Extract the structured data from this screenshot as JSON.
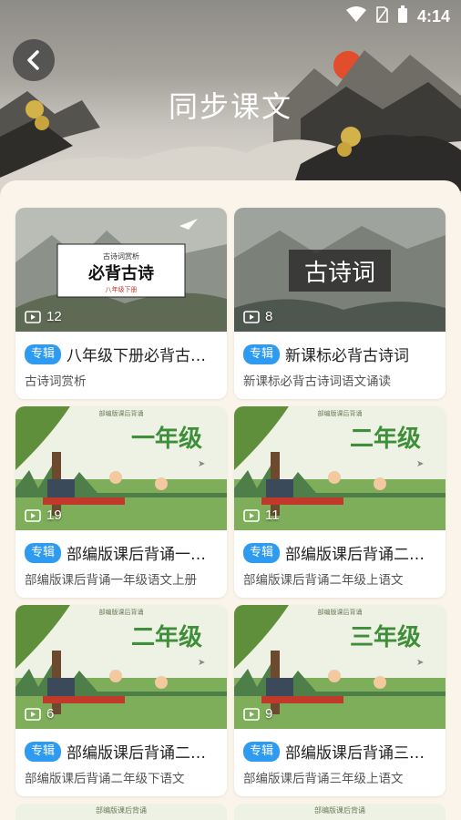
{
  "status_bar": {
    "time": "4:14",
    "icons": [
      "wifi-icon",
      "sim-icon",
      "battery-icon"
    ]
  },
  "header": {
    "title": "同步课文",
    "back_icon": "chevron-left-icon"
  },
  "cards": [
    {
      "badge": "专辑",
      "name": "八年级下册必背古诗词",
      "subtitle": "古诗词赏析",
      "count": "12",
      "theme": "ink",
      "thumb_text": "必背古诗",
      "thumb_top": "古诗词赏析",
      "thumb_bottom": "八年级下册"
    },
    {
      "badge": "专辑",
      "name": "新课标必背古诗词",
      "subtitle": "新课标必背古诗词语文诵读",
      "count": "8",
      "theme": "ink2",
      "thumb_text": "古诗词"
    },
    {
      "badge": "专辑",
      "name": "部编版课后背诵一年级",
      "subtitle": "部编版课后背诵一年级语文上册",
      "count": "19",
      "theme": "grade",
      "thumb_text": "一年级",
      "thumb_top": "部编版课后背诵"
    },
    {
      "badge": "专辑",
      "name": "部编版课后背诵二年级",
      "subtitle": "部编版课后背诵二年级上语文",
      "count": "11",
      "theme": "grade",
      "thumb_text": "二年级",
      "thumb_top": "部编版课后背诵"
    },
    {
      "badge": "专辑",
      "name": "部编版课后背诵二年级",
      "subtitle": "部编版课后背诵二年级下语文",
      "count": "6",
      "theme": "grade",
      "thumb_text": "二年级",
      "thumb_top": "部编版课后背诵"
    },
    {
      "badge": "专辑",
      "name": "部编版课后背诵三年级",
      "subtitle": "部编版课后背诵三年级上语文",
      "count": "9",
      "theme": "grade",
      "thumb_text": "三年级",
      "thumb_top": "部编版课后背诵"
    }
  ],
  "partial": [
    "部编版课后背诵",
    "部编版课后背诵"
  ],
  "colors": {
    "badge": "#2f9bf0",
    "grade_text": "#3f8f3a",
    "panel": "#fbf4ea"
  }
}
